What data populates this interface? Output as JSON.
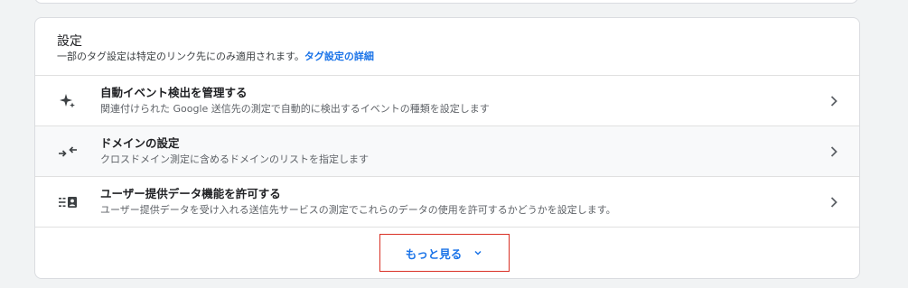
{
  "settings": {
    "title": "設定",
    "subtitle": "一部のタグ設定は特定のリンク先にのみ適用されます。",
    "link_label": "タグ設定の詳細"
  },
  "rows": [
    {
      "icon": "sparkle-icon",
      "title": "自動イベント検出を管理する",
      "description": "関連付けられた Google 送信先の測定で自動的に検出するイベントの種類を設定します"
    },
    {
      "icon": "merge-arrows-icon",
      "title": "ドメインの設定",
      "description": "クロスドメイン測定に含めるドメインのリストを指定します"
    },
    {
      "icon": "user-data-icon",
      "title": "ユーザー提供データ機能を許可する",
      "description": "ユーザー提供データを受け入れる送信先サービスの測定でこれらのデータの使用を許可するかどうかを設定します。"
    }
  ],
  "more_button": {
    "label": "もっと見る"
  },
  "colors": {
    "link": "#1a73e8",
    "highlight_border": "#d93025",
    "hover_row": "#f8f9fa"
  }
}
